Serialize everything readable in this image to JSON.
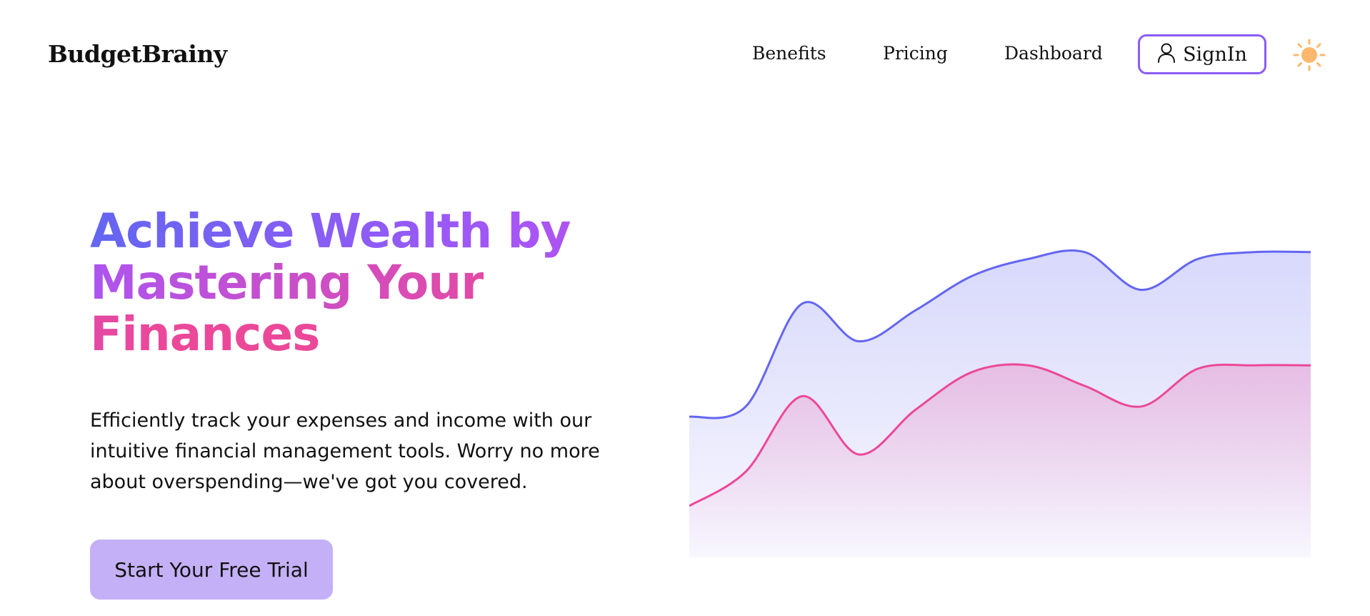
{
  "nav": {
    "brand": "BudgetBrainy",
    "links": [
      "Benefits",
      "Pricing",
      "Dashboard"
    ],
    "signin_label": "SignIn",
    "signin_icon": "user-icon",
    "theme_icon": "sun-icon"
  },
  "hero": {
    "title": "Achieve Wealth by Mastering Your Finances",
    "subtitle": "Efficiently track your expenses and income with our intuitive financial management tools. Worry no more about overspending—we've got you covered.",
    "cta_label": "Start Your Free Trial"
  },
  "colors": {
    "accent_purple": "#8b5cf6",
    "indigo": "#6366f1",
    "pink": "#ec4899",
    "cta_bg": "#c4b0f7",
    "sun": "#fbb86c"
  },
  "chart_data": {
    "type": "area",
    "title": "",
    "xlabel": "",
    "ylabel": "",
    "grid": false,
    "legend": "none",
    "ylim": [
      0,
      100
    ],
    "x": [
      0,
      1,
      2,
      3,
      4,
      5,
      6,
      7,
      8,
      9,
      10,
      11
    ],
    "series": [
      {
        "values": [
          41,
          44,
          74,
          63,
          72,
          82,
          87,
          89,
          78,
          87,
          89,
          89
        ],
        "color": "#6366f1"
      },
      {
        "values": [
          15,
          25,
          47,
          30,
          43,
          54,
          56,
          50,
          44,
          55,
          56,
          56
        ],
        "color": "#ec4899"
      }
    ]
  }
}
